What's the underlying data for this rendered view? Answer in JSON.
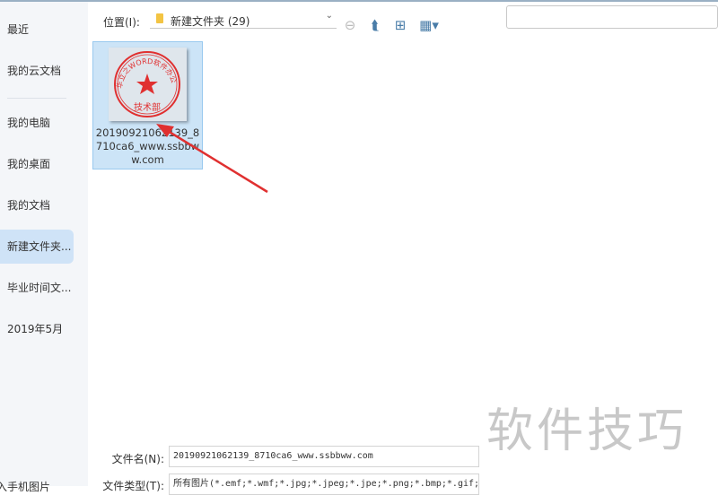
{
  "sidebar": {
    "items": [
      "最近",
      "我的云文档",
      "我的电脑",
      "我的桌面",
      "我的文档",
      "新建文件夹...",
      "毕业时间文...",
      "2019年5月"
    ],
    "bottom": "导入手机图片"
  },
  "location": {
    "label": "位置(I):",
    "value": "新建文件夹 (29)"
  },
  "toolbar": {
    "back": "back-icon",
    "up": "folder-up-icon",
    "new": "new-folder-icon",
    "view": "view-grid-icon"
  },
  "file": {
    "name": "20190921062139_8710ca6_www.ssbbww.com",
    "stamp_text": "华立之WORD软件办公",
    "stamp_bottom": "技术部"
  },
  "form": {
    "filename_label": "文件名(N):",
    "filename_value": "20190921062139_8710ca6_www.ssbbww.com",
    "filetype_label": "文件类型(T):",
    "filetype_value": "所有图片(*.emf;*.wmf;*.jpg;*.jpeg;*.jpe;*.png;*.bmp;*.gif;*.tif;*.tiff;*"
  },
  "watermark": "软件技巧"
}
